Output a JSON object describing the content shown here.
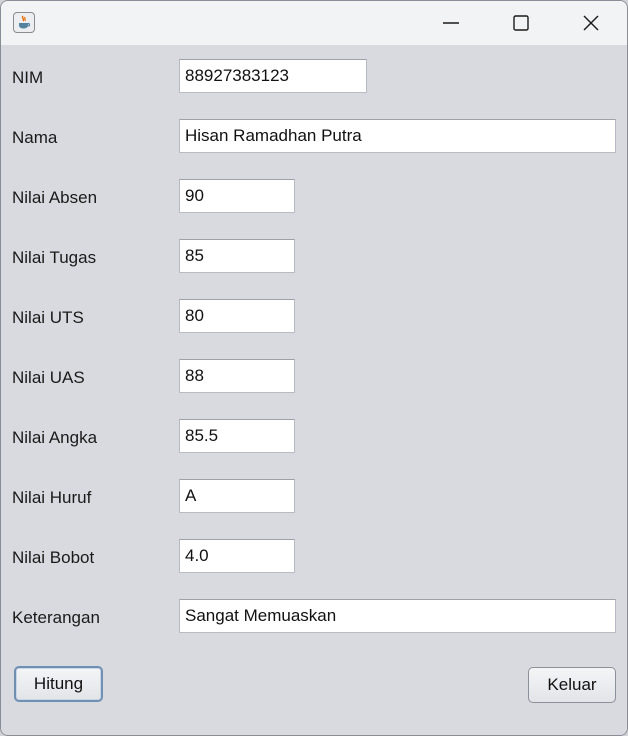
{
  "window": {
    "title": ""
  },
  "icons": {
    "app": "java-coffee-cup-icon",
    "minimize": "minimize-icon",
    "maximize": "maximize-icon",
    "close": "close-icon"
  },
  "form": {
    "fields": [
      {
        "label": "NIM",
        "value": "88927383123"
      },
      {
        "label": "Nama",
        "value": "Hisan Ramadhan Putra"
      },
      {
        "label": "Nilai Absen",
        "value": "90"
      },
      {
        "label": "Nilai Tugas",
        "value": "85"
      },
      {
        "label": "Nilai UTS",
        "value": "80"
      },
      {
        "label": "Nilai UAS",
        "value": "88"
      },
      {
        "label": "Nilai Angka",
        "value": "85.5"
      },
      {
        "label": "Nilai Huruf",
        "value": "A"
      },
      {
        "label": "Nilai Bobot",
        "value": "4.0"
      },
      {
        "label": "Keterangan",
        "value": "Sangat Memuaskan"
      }
    ]
  },
  "buttons": {
    "hitung": "Hitung",
    "keluar": "Keluar"
  }
}
